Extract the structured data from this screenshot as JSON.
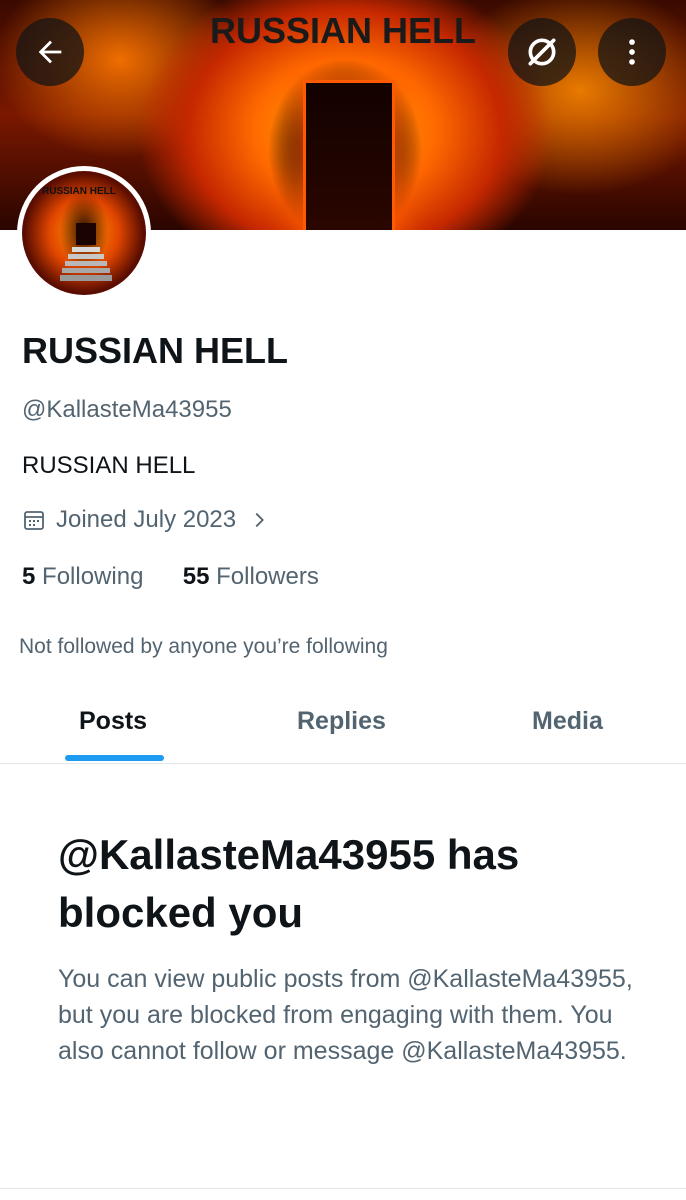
{
  "banner": {
    "title": "RUSSIAN HELL"
  },
  "avatar": {
    "text": "RUSSIAN HELL"
  },
  "header_icons": [
    "back-arrow-icon",
    "no-signal-icon",
    "more-vertical-icon"
  ],
  "profile": {
    "name": "RUSSIAN HELL",
    "handle": "@KallasteMa43955",
    "bio": "RUSSIAN HELL",
    "joined": "Joined July 2023",
    "following_count": "5",
    "following_label": "Following",
    "followers_count": "55",
    "followers_label": "Followers",
    "not_followed": "Not followed by anyone you’re following"
  },
  "tabs": [
    {
      "label": "Posts",
      "active": true
    },
    {
      "label": "Replies",
      "active": false
    },
    {
      "label": "Media",
      "active": false
    }
  ],
  "blocked": {
    "title": "@KallasteMa43955 has blocked you",
    "description": "You can view public posts from @KallasteMa43955, but you are blocked from engaging with them. You also cannot follow or message @KallasteMa43955."
  },
  "colors": {
    "accent": "#1d9bf0",
    "text": "#0f1419",
    "secondary": "#536471"
  }
}
